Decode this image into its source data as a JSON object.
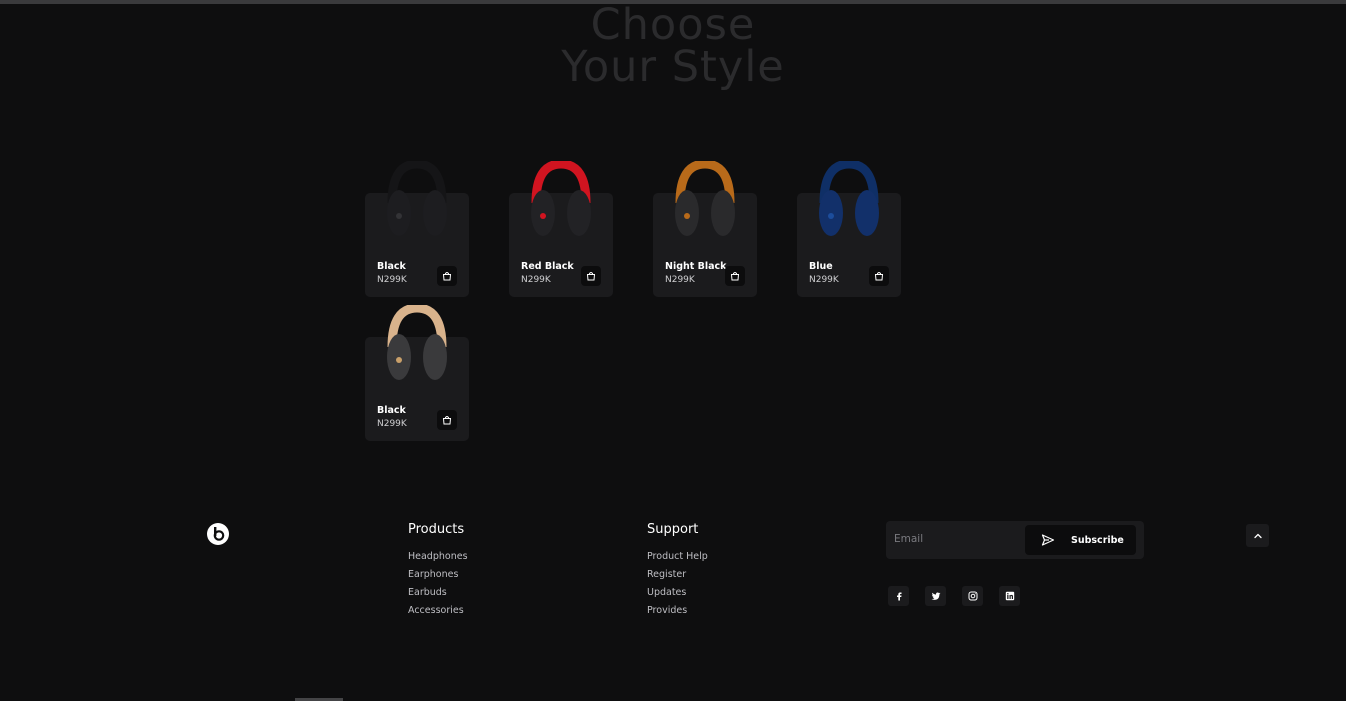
{
  "hero": {
    "line1": "Choose",
    "line2": "Your Style"
  },
  "products": [
    {
      "name": "Black",
      "price": "N299K",
      "band": "#151517",
      "cup": "#1d1d20",
      "accent": "#333336"
    },
    {
      "name": "Red Black",
      "price": "N299K",
      "band": "#d11420",
      "cup": "#222225",
      "accent": "#d11420"
    },
    {
      "name": "Night Black",
      "price": "N299K",
      "band": "#b86a1a",
      "cup": "#2a2a2c",
      "accent": "#b86a1a"
    },
    {
      "name": "Blue",
      "price": "N299K",
      "band": "#0f2f66",
      "cup": "#12306a",
      "accent": "#1c4d9c"
    },
    {
      "name": "Black",
      "price": "N299K",
      "band": "#d9b38c",
      "cup": "#3a3a3c",
      "accent": "#c9a06a"
    }
  ],
  "footer": {
    "products": {
      "title": "Products",
      "links": [
        "Headphones",
        "Earphones",
        "Earbuds",
        "Accessories"
      ]
    },
    "support": {
      "title": "Support",
      "links": [
        "Product Help",
        "Register",
        "Updates",
        "Provides"
      ]
    },
    "subscribe": {
      "placeholder": "Email",
      "button": "Subscribe"
    },
    "social": [
      "facebook-icon",
      "twitter-icon",
      "instagram-icon",
      "linkedin-icon"
    ]
  }
}
